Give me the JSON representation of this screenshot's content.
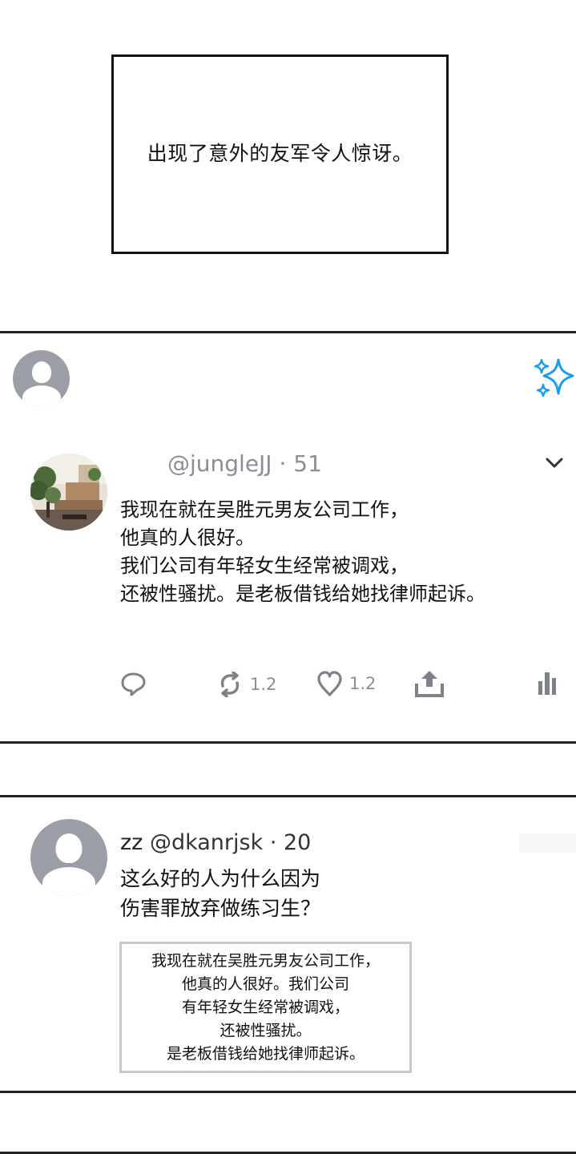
{
  "caption": {
    "text": "出现了意外的友军令人惊讶。"
  },
  "header": {
    "avatar": "user-placeholder-icon",
    "sparkle_icon": "sparkle-icon",
    "sparkle_color": "#1d9bf0"
  },
  "post": {
    "avatar": "photo-avatar-interior",
    "handle": "@jungleJJ",
    "separator": "·",
    "time": "51",
    "text": "我现在就在吴胜元男友公司工作，\n他真的人很好。\n我们公司有年轻女生经常被调戏，\n还被性骚扰。是老板借钱给她找律师起诉。",
    "actions": {
      "reply_icon": "reply-icon",
      "retweet_icon": "retweet-icon",
      "retweet_count": "1.2",
      "like_icon": "heart-icon",
      "like_count": "1.2",
      "share_icon": "share-icon",
      "stats_icon": "stats-icon"
    }
  },
  "reply": {
    "avatar": "user-placeholder-icon",
    "name": "zz",
    "handle": "@dkanrjsk",
    "separator": "·",
    "time": "20",
    "text": "这么好的人为什么因为\n伤害罪放弃做练习生？",
    "quote": "我现在就在吴胜元男友公司工作，\n他真的人很好。我们公司\n有年轻女生经常被调戏，\n还被性骚扰。\n是老板借钱给她找律师起诉。"
  }
}
